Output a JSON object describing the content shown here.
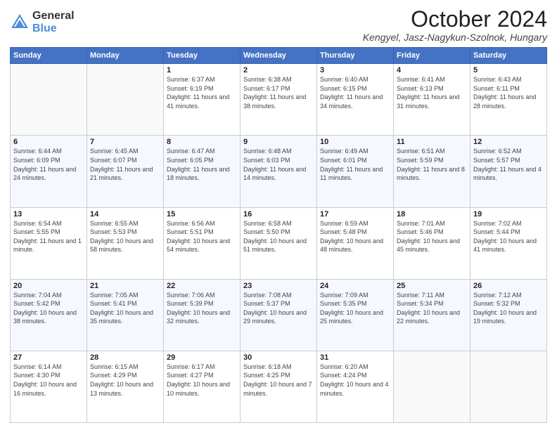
{
  "header": {
    "logo": {
      "general": "General",
      "blue": "Blue"
    },
    "title": "October 2024",
    "subtitle": "Kengyel, Jasz-Nagykun-Szolnok, Hungary"
  },
  "days_of_week": [
    "Sunday",
    "Monday",
    "Tuesday",
    "Wednesday",
    "Thursday",
    "Friday",
    "Saturday"
  ],
  "weeks": [
    [
      {
        "day": "",
        "sunrise": "",
        "sunset": "",
        "daylight": ""
      },
      {
        "day": "",
        "sunrise": "",
        "sunset": "",
        "daylight": ""
      },
      {
        "day": "1",
        "sunrise": "Sunrise: 6:37 AM",
        "sunset": "Sunset: 6:19 PM",
        "daylight": "Daylight: 11 hours and 41 minutes."
      },
      {
        "day": "2",
        "sunrise": "Sunrise: 6:38 AM",
        "sunset": "Sunset: 6:17 PM",
        "daylight": "Daylight: 11 hours and 38 minutes."
      },
      {
        "day": "3",
        "sunrise": "Sunrise: 6:40 AM",
        "sunset": "Sunset: 6:15 PM",
        "daylight": "Daylight: 11 hours and 34 minutes."
      },
      {
        "day": "4",
        "sunrise": "Sunrise: 6:41 AM",
        "sunset": "Sunset: 6:13 PM",
        "daylight": "Daylight: 11 hours and 31 minutes."
      },
      {
        "day": "5",
        "sunrise": "Sunrise: 6:43 AM",
        "sunset": "Sunset: 6:11 PM",
        "daylight": "Daylight: 11 hours and 28 minutes."
      }
    ],
    [
      {
        "day": "6",
        "sunrise": "Sunrise: 6:44 AM",
        "sunset": "Sunset: 6:09 PM",
        "daylight": "Daylight: 11 hours and 24 minutes."
      },
      {
        "day": "7",
        "sunrise": "Sunrise: 6:45 AM",
        "sunset": "Sunset: 6:07 PM",
        "daylight": "Daylight: 11 hours and 21 minutes."
      },
      {
        "day": "8",
        "sunrise": "Sunrise: 6:47 AM",
        "sunset": "Sunset: 6:05 PM",
        "daylight": "Daylight: 11 hours and 18 minutes."
      },
      {
        "day": "9",
        "sunrise": "Sunrise: 6:48 AM",
        "sunset": "Sunset: 6:03 PM",
        "daylight": "Daylight: 11 hours and 14 minutes."
      },
      {
        "day": "10",
        "sunrise": "Sunrise: 6:49 AM",
        "sunset": "Sunset: 6:01 PM",
        "daylight": "Daylight: 11 hours and 11 minutes."
      },
      {
        "day": "11",
        "sunrise": "Sunrise: 6:51 AM",
        "sunset": "Sunset: 5:59 PM",
        "daylight": "Daylight: 11 hours and 8 minutes."
      },
      {
        "day": "12",
        "sunrise": "Sunrise: 6:52 AM",
        "sunset": "Sunset: 5:57 PM",
        "daylight": "Daylight: 11 hours and 4 minutes."
      }
    ],
    [
      {
        "day": "13",
        "sunrise": "Sunrise: 6:54 AM",
        "sunset": "Sunset: 5:55 PM",
        "daylight": "Daylight: 11 hours and 1 minute."
      },
      {
        "day": "14",
        "sunrise": "Sunrise: 6:55 AM",
        "sunset": "Sunset: 5:53 PM",
        "daylight": "Daylight: 10 hours and 58 minutes."
      },
      {
        "day": "15",
        "sunrise": "Sunrise: 6:56 AM",
        "sunset": "Sunset: 5:51 PM",
        "daylight": "Daylight: 10 hours and 54 minutes."
      },
      {
        "day": "16",
        "sunrise": "Sunrise: 6:58 AM",
        "sunset": "Sunset: 5:50 PM",
        "daylight": "Daylight: 10 hours and 51 minutes."
      },
      {
        "day": "17",
        "sunrise": "Sunrise: 6:59 AM",
        "sunset": "Sunset: 5:48 PM",
        "daylight": "Daylight: 10 hours and 48 minutes."
      },
      {
        "day": "18",
        "sunrise": "Sunrise: 7:01 AM",
        "sunset": "Sunset: 5:46 PM",
        "daylight": "Daylight: 10 hours and 45 minutes."
      },
      {
        "day": "19",
        "sunrise": "Sunrise: 7:02 AM",
        "sunset": "Sunset: 5:44 PM",
        "daylight": "Daylight: 10 hours and 41 minutes."
      }
    ],
    [
      {
        "day": "20",
        "sunrise": "Sunrise: 7:04 AM",
        "sunset": "Sunset: 5:42 PM",
        "daylight": "Daylight: 10 hours and 38 minutes."
      },
      {
        "day": "21",
        "sunrise": "Sunrise: 7:05 AM",
        "sunset": "Sunset: 5:41 PM",
        "daylight": "Daylight: 10 hours and 35 minutes."
      },
      {
        "day": "22",
        "sunrise": "Sunrise: 7:06 AM",
        "sunset": "Sunset: 5:39 PM",
        "daylight": "Daylight: 10 hours and 32 minutes."
      },
      {
        "day": "23",
        "sunrise": "Sunrise: 7:08 AM",
        "sunset": "Sunset: 5:37 PM",
        "daylight": "Daylight: 10 hours and 29 minutes."
      },
      {
        "day": "24",
        "sunrise": "Sunrise: 7:09 AM",
        "sunset": "Sunset: 5:35 PM",
        "daylight": "Daylight: 10 hours and 25 minutes."
      },
      {
        "day": "25",
        "sunrise": "Sunrise: 7:11 AM",
        "sunset": "Sunset: 5:34 PM",
        "daylight": "Daylight: 10 hours and 22 minutes."
      },
      {
        "day": "26",
        "sunrise": "Sunrise: 7:12 AM",
        "sunset": "Sunset: 5:32 PM",
        "daylight": "Daylight: 10 hours and 19 minutes."
      }
    ],
    [
      {
        "day": "27",
        "sunrise": "Sunrise: 6:14 AM",
        "sunset": "Sunset: 4:30 PM",
        "daylight": "Daylight: 10 hours and 16 minutes."
      },
      {
        "day": "28",
        "sunrise": "Sunrise: 6:15 AM",
        "sunset": "Sunset: 4:29 PM",
        "daylight": "Daylight: 10 hours and 13 minutes."
      },
      {
        "day": "29",
        "sunrise": "Sunrise: 6:17 AM",
        "sunset": "Sunset: 4:27 PM",
        "daylight": "Daylight: 10 hours and 10 minutes."
      },
      {
        "day": "30",
        "sunrise": "Sunrise: 6:18 AM",
        "sunset": "Sunset: 4:25 PM",
        "daylight": "Daylight: 10 hours and 7 minutes."
      },
      {
        "day": "31",
        "sunrise": "Sunrise: 6:20 AM",
        "sunset": "Sunset: 4:24 PM",
        "daylight": "Daylight: 10 hours and 4 minutes."
      },
      {
        "day": "",
        "sunrise": "",
        "sunset": "",
        "daylight": ""
      },
      {
        "day": "",
        "sunrise": "",
        "sunset": "",
        "daylight": ""
      }
    ]
  ]
}
